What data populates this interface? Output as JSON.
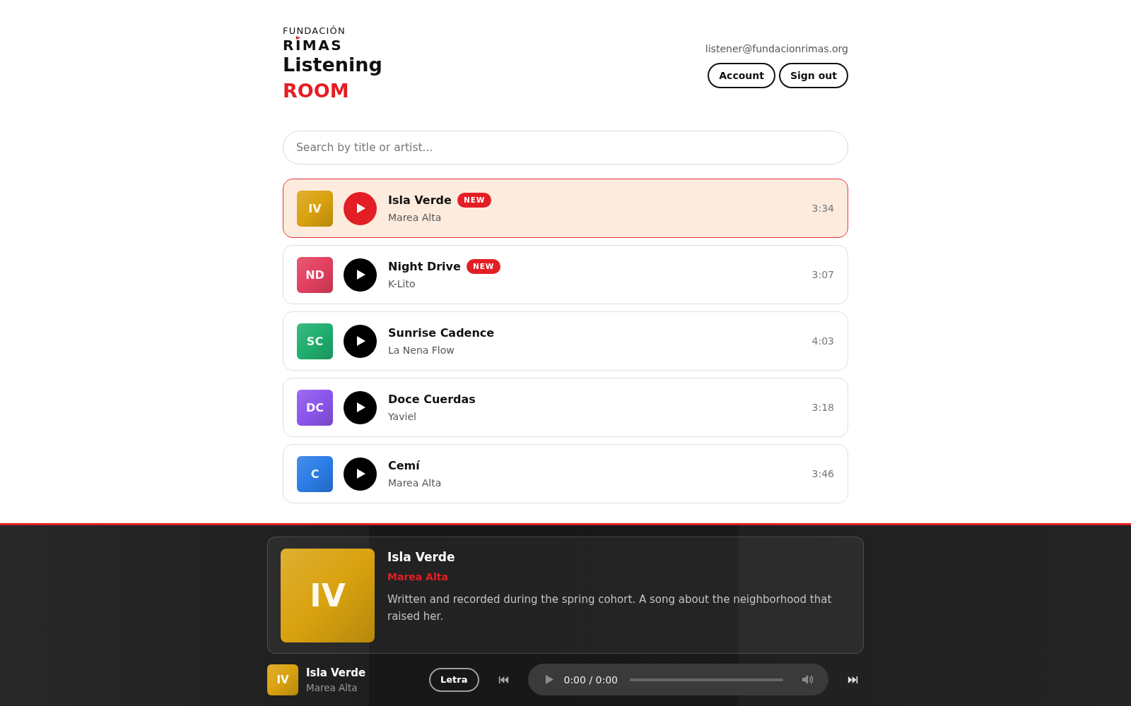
{
  "brand": {
    "org": "FUNDACIÓN",
    "name": "RIMAS",
    "title": "Listening",
    "subtitle": "ROOM"
  },
  "user": {
    "email": "listener@fundacionrimas.org",
    "buttons": [
      "Account",
      "Sign out"
    ]
  },
  "search": {
    "placeholder": "Search by title or artist..."
  },
  "tracks": [
    {
      "initials": "IV",
      "title": "Isla Verde",
      "artist": "Marea Alta",
      "duration": "3:34",
      "badge": "NEW",
      "color": "#d9a20f",
      "selected": true
    },
    {
      "initials": "ND",
      "title": "Night Drive",
      "artist": "K-Lito",
      "duration": "3:07",
      "badge": "NEW",
      "color": "#e2405f",
      "selected": false
    },
    {
      "initials": "SC",
      "title": "Sunrise Cadence",
      "artist": "La Nena Flow",
      "duration": "4:03",
      "color": "#1fae6e",
      "selected": false
    },
    {
      "initials": "DC",
      "title": "Doce Cuerdas",
      "artist": "Yaviel",
      "duration": "3:18",
      "color": "#8b55ec",
      "selected": false
    },
    {
      "initials": "C",
      "title": "Cemí",
      "artist": "Marea Alta",
      "duration": "3:46",
      "color": "#2b7ce6",
      "selected": false
    }
  ],
  "now_playing": {
    "initials": "IV",
    "title": "Isla Verde",
    "artist": "Marea Alta",
    "description": "Written and recorded during the spring cohort. A song about the neighborhood that raised her."
  },
  "player": {
    "initials": "IV",
    "title": "Isla Verde",
    "artist": "Marea Alta",
    "lyrics_button": "Letra",
    "time": "0:00 / 0:00"
  }
}
